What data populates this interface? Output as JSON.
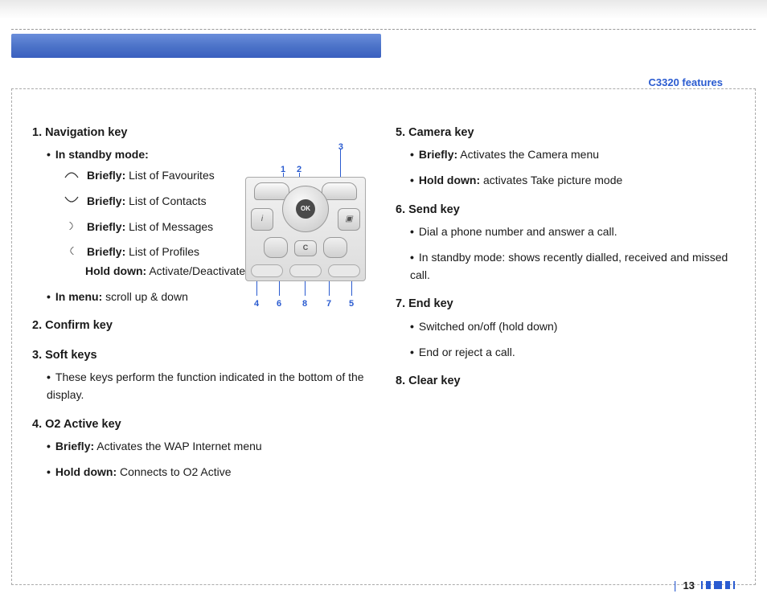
{
  "header": {
    "section_label": "C3320 features"
  },
  "page_number": "13",
  "diagram": {
    "ok_label": "OK",
    "clear_label": "C",
    "callouts_top": [
      "1",
      "2",
      "3"
    ],
    "callouts_bottom": [
      "4",
      "6",
      "8",
      "7",
      "5"
    ]
  },
  "left": {
    "k1": {
      "title": "1. Navigation key",
      "standby_label": "In standby mode:",
      "up": {
        "b": "Briefly:",
        "t": "List of Favourites"
      },
      "down": {
        "b": "Briefly:",
        "t": "List of Contacts"
      },
      "right": {
        "b": "Briefly:",
        "t": "List of Messages"
      },
      "left": {
        "b": "Briefly:",
        "t": "List of Profiles"
      },
      "hold": {
        "b": "Hold down:",
        "t": "Activate/Deactivate Vibrate mode"
      },
      "inmenu_label": "In menu:",
      "inmenu_text": "scroll up & down"
    },
    "k2": {
      "title": "2. Confirm key"
    },
    "k3": {
      "title": "3. Soft keys",
      "b1": "These keys perform the function indicated in the bottom of the display."
    },
    "k4": {
      "title": "4. O2 Active key",
      "brief_b": "Briefly:",
      "brief_t": "Activates the WAP Internet menu",
      "hold_b": "Hold down:",
      "hold_t": "Connects to O2 Active"
    }
  },
  "right": {
    "k5": {
      "title": "5. Camera key",
      "brief_b": "Briefly:",
      "brief_t": "Activates the Camera menu",
      "hold_b": "Hold down:",
      "hold_t": "activates Take picture mode"
    },
    "k6": {
      "title": "6. Send key",
      "b1": "Dial a phone number and answer a call.",
      "b2": "In standby mode: shows recently dialled, received and missed call."
    },
    "k7": {
      "title": "7. End key",
      "b1": "Switched on/off (hold down)",
      "b2": "End or reject a call."
    },
    "k8": {
      "title": "8. Clear key"
    }
  }
}
